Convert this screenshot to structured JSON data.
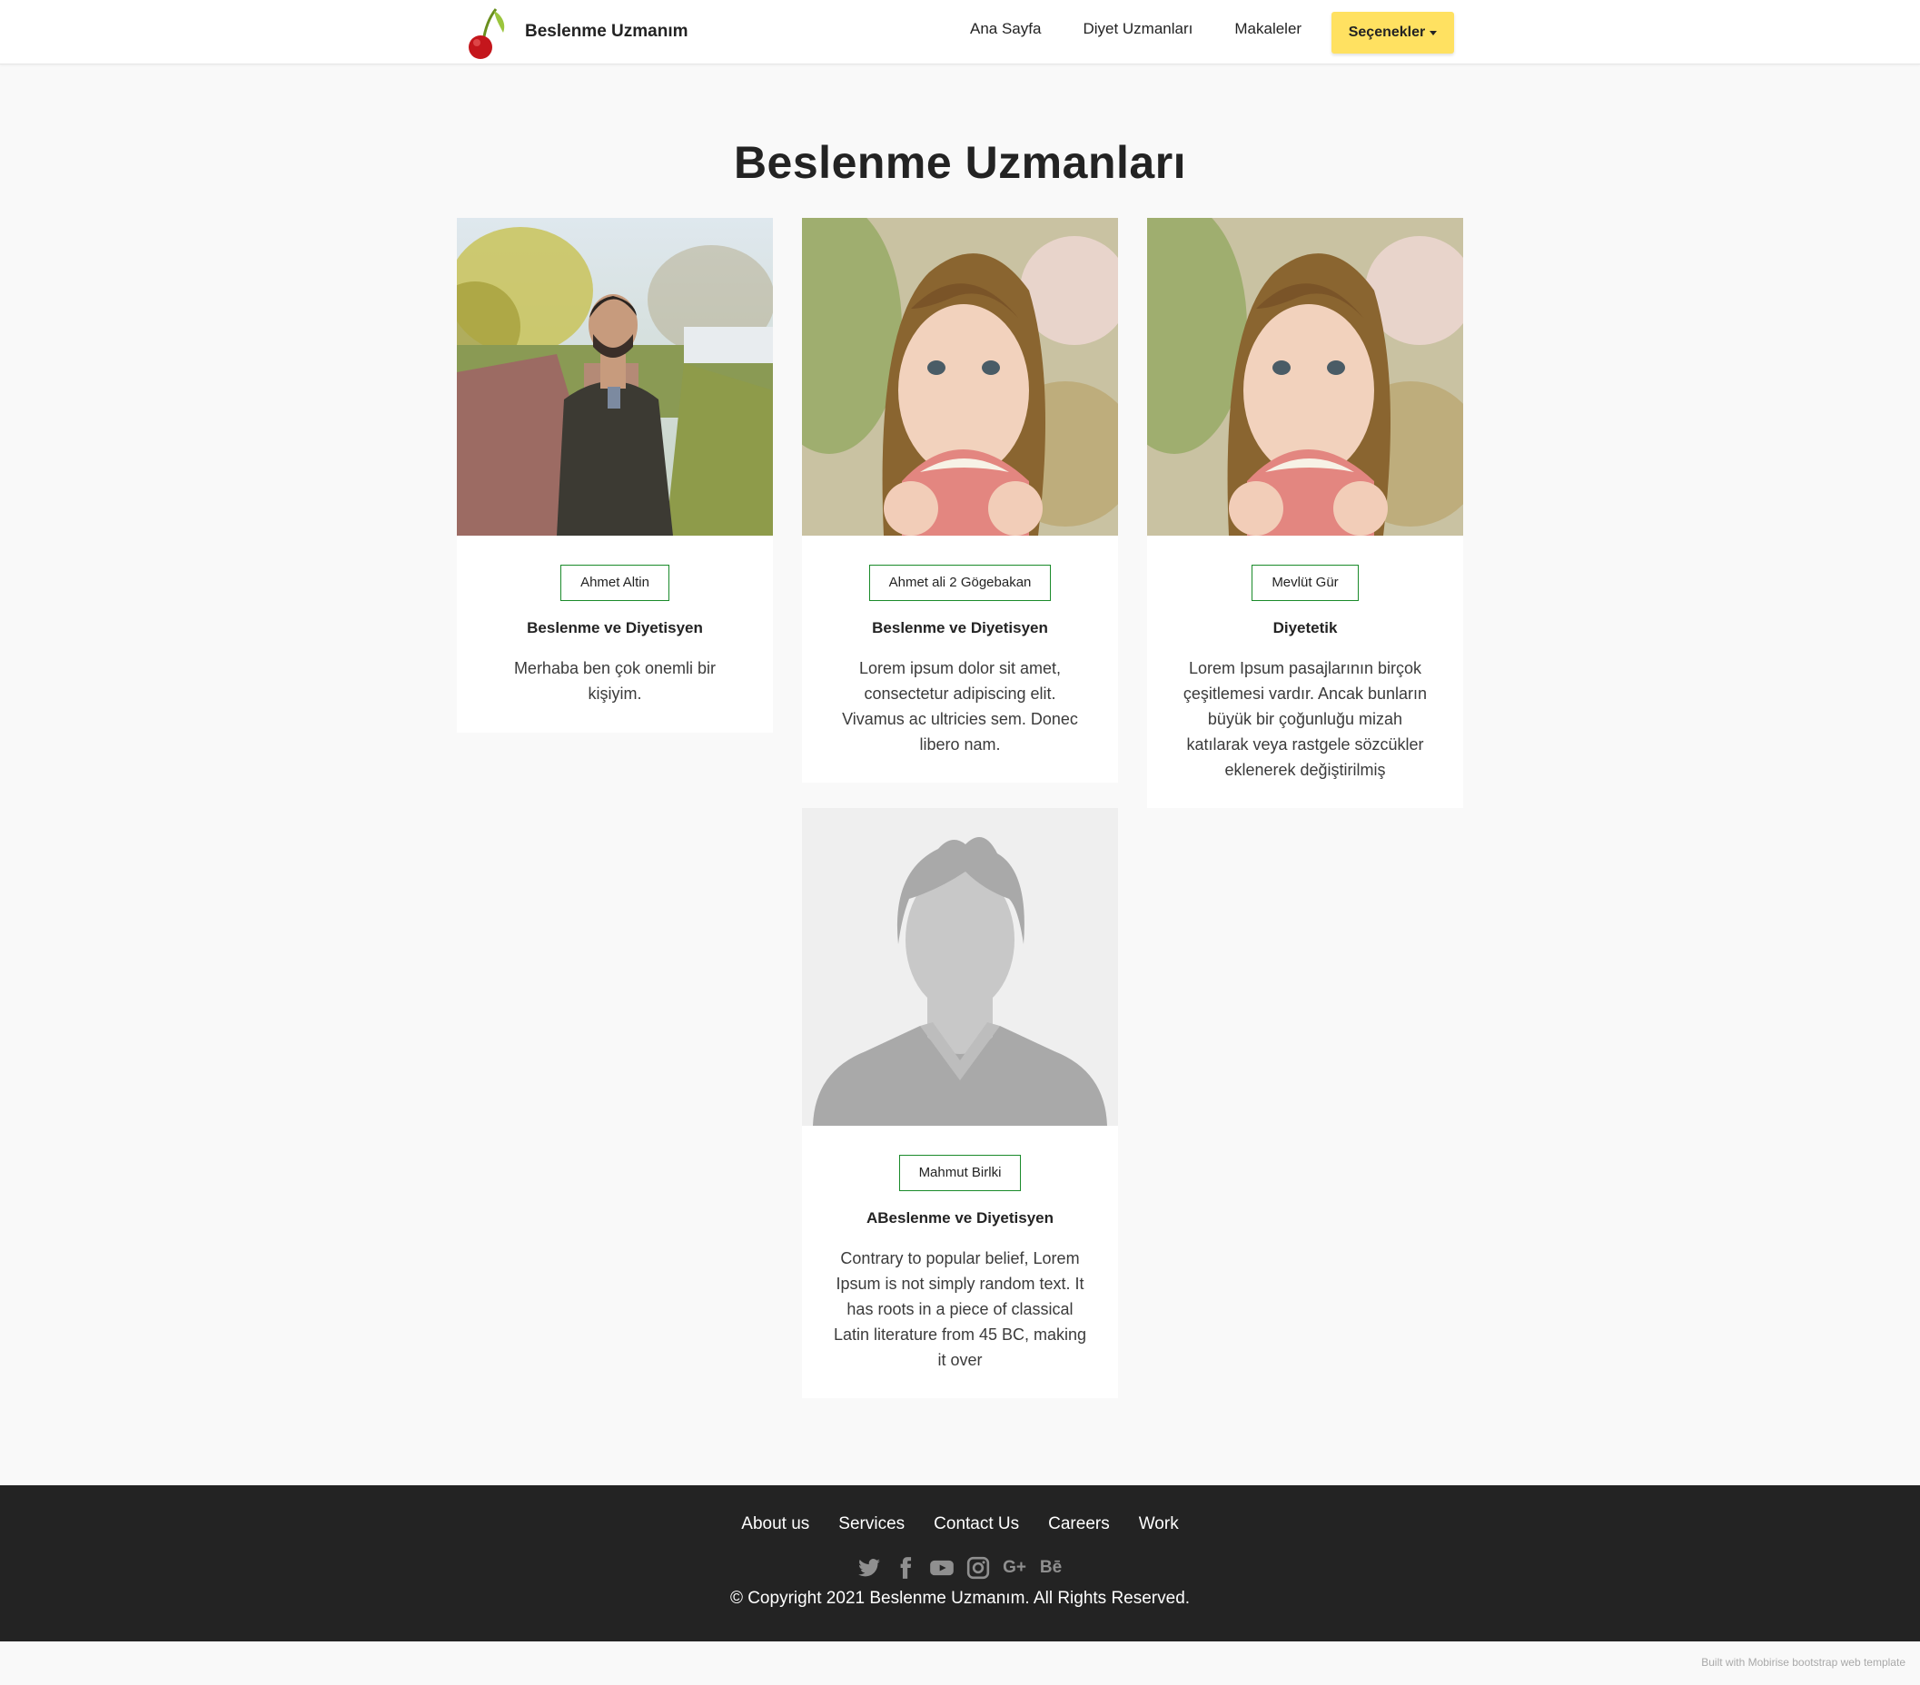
{
  "nav": {
    "brand": "Beslenme Uzmanım",
    "links": [
      "Ana Sayfa",
      "Diyet Uzmanları",
      "Makaleler"
    ],
    "dropdown": "Seçenekler"
  },
  "page_title": "Beslenme Uzmanları",
  "cards": [
    {
      "name": "Ahmet Altin",
      "role": "Beslenme ve Diyetisyen",
      "desc": "Merhaba ben çok onemli bir kişiyim."
    },
    {
      "name": "Ahmet ali 2 Gögebakan",
      "role": "Beslenme ve Diyetisyen",
      "desc": "Lorem ipsum dolor sit amet, consectetur adipiscing elit. Vivamus ac ultricies sem. Donec libero nam."
    },
    {
      "name": "Mevlüt Gür",
      "role": "Diyetetik",
      "desc": "Lorem Ipsum pasajlarının birçok çeşitlemesi vardır. Ancak bunların büyük bir çoğunluğu mizah katılarak veya rastgele sözcükler eklenerek değiştirilmiş"
    },
    {
      "name": "Mahmut Birlki",
      "role": "ABeslenme ve Diyetisyen",
      "desc": "Contrary to popular belief, Lorem Ipsum is not simply random text. It has roots in a piece of classical Latin literature from 45 BC, making it over"
    }
  ],
  "footer": {
    "links": [
      "About us",
      "Services",
      "Contact Us",
      "Careers",
      "Work"
    ],
    "social_icons": [
      "twitter-icon",
      "facebook-icon",
      "youtube-icon",
      "instagram-icon",
      "google-plus-icon",
      "behance-icon"
    ],
    "social_glyphs": {
      "google": "G+",
      "behance": "Bē"
    },
    "copyright": "© Copyright 2021 Beslenme Uzmanım. All Rights Reserved."
  },
  "built_with": "Built with Mobirise bootstrap web template",
  "colors": {
    "accent": "#ffe161",
    "tag_border": "#1a8a2a",
    "footer_bg": "#232323",
    "page_bg": "#f9f9f9"
  }
}
